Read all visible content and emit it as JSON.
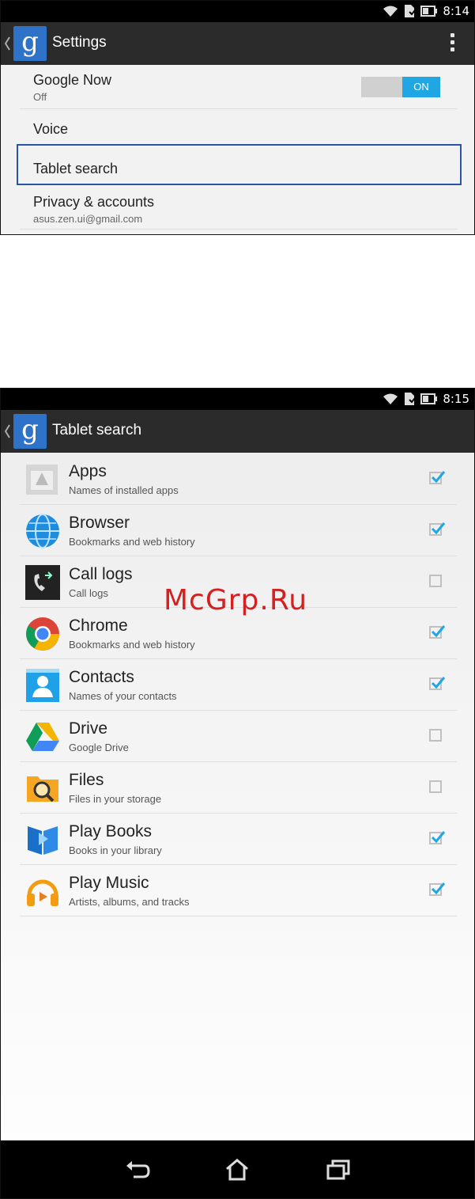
{
  "screen1": {
    "status_time": "8:14",
    "title": "Settings",
    "items": [
      {
        "title": "Google Now",
        "subtitle": "Off",
        "toggle": "ON"
      },
      {
        "title": "Voice"
      },
      {
        "title": "Tablet search"
      },
      {
        "title": "Privacy & accounts",
        "subtitle": "asus.zen.ui@gmail.com"
      }
    ]
  },
  "screen2": {
    "status_time": "8:15",
    "title": "Tablet search",
    "items": [
      {
        "title": "Apps",
        "subtitle": "Names of installed apps",
        "checked": true,
        "icon": "apps-icon"
      },
      {
        "title": "Browser",
        "subtitle": "Bookmarks and web history",
        "checked": true,
        "icon": "browser-icon"
      },
      {
        "title": "Call logs",
        "subtitle": "Call logs",
        "checked": false,
        "icon": "call-logs-icon"
      },
      {
        "title": "Chrome",
        "subtitle": "Bookmarks and web history",
        "checked": true,
        "icon": "chrome-icon"
      },
      {
        "title": "Contacts",
        "subtitle": "Names of your contacts",
        "checked": true,
        "icon": "contacts-icon"
      },
      {
        "title": "Drive",
        "subtitle": "Google Drive",
        "checked": false,
        "icon": "drive-icon"
      },
      {
        "title": "Files",
        "subtitle": "Files in your storage",
        "checked": false,
        "icon": "files-icon"
      },
      {
        "title": "Play Books",
        "subtitle": "Books in your library",
        "checked": true,
        "icon": "play-books-icon"
      },
      {
        "title": "Play Music",
        "subtitle": "Artists, albums, and tracks",
        "checked": true,
        "icon": "play-music-icon"
      }
    ],
    "nav": [
      "back-icon",
      "home-icon",
      "recent-apps-icon"
    ]
  },
  "watermark": "McGrp.Ru",
  "colors": {
    "accent": "#1fa6e3",
    "highlight": "#2856a4",
    "action_bar": "#2b2b2b",
    "google_blue": "#2f73c9"
  }
}
